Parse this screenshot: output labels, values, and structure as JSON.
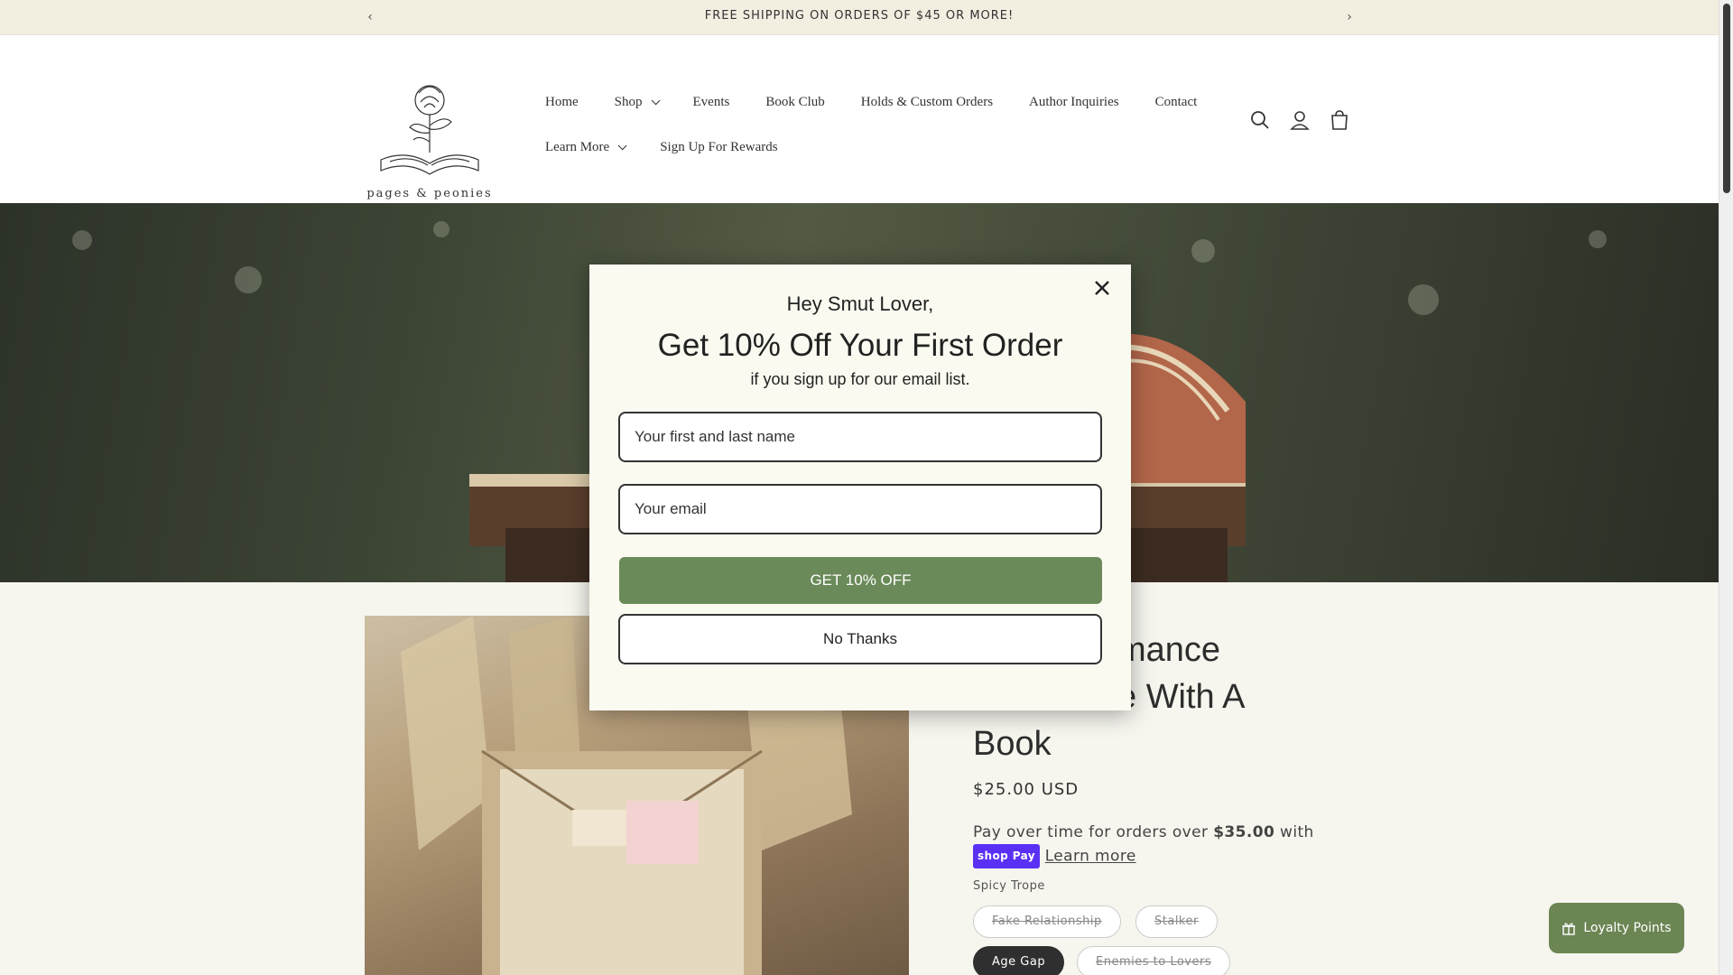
{
  "announcement": {
    "text": "FREE SHIPPING ON ORDERS OF $45 OR MORE!",
    "prev_icon": "chevron-left-icon",
    "next_icon": "chevron-right-icon"
  },
  "logo": {
    "text": "pages & peonies"
  },
  "nav": {
    "row1": [
      "Home",
      "Shop",
      "Events",
      "Book Club",
      "Holds & Custom Orders",
      "Author Inquiries",
      "Contact"
    ],
    "row2": [
      "Learn More",
      "Sign Up For Rewards"
    ]
  },
  "header_icons": [
    "search-icon",
    "account-icon",
    "cart-icon"
  ],
  "product": {
    "title": "...mance\n...e With A\nBook",
    "title_lines": [
      "mance",
      "e With A",
      "Book"
    ],
    "price": "$25.00 USD",
    "payover_text": "Pay over time for orders over",
    "payover_amount": "$35.00",
    "payover_suffix": "with",
    "shoppay_label": "shop Pay",
    "learn_more": "Learn more",
    "trope_label": "Spicy Trope",
    "tropes": [
      {
        "label": "Fake Relationship",
        "state": "unavailable"
      },
      {
        "label": "Stalker",
        "state": "unavailable"
      },
      {
        "label": "Age Gap",
        "state": "selected"
      },
      {
        "label": "Enemies to Lovers",
        "state": "unavailable"
      }
    ]
  },
  "loyalty": {
    "label": "Loyalty Points"
  },
  "modal": {
    "greeting": "Hey Smut Lover,",
    "headline": "Get 10% Off Your First Order",
    "subtext": "if you sign up for our email list.",
    "name_placeholder": "Your first and last name",
    "email_placeholder": "Your email",
    "cta_label": "GET 10% OFF",
    "decline_label": "No Thanks"
  },
  "colors": {
    "accent_green": "#6b8a5a",
    "announcement_bg": "#f2eee0",
    "modal_bg": "#fbfaf1"
  }
}
